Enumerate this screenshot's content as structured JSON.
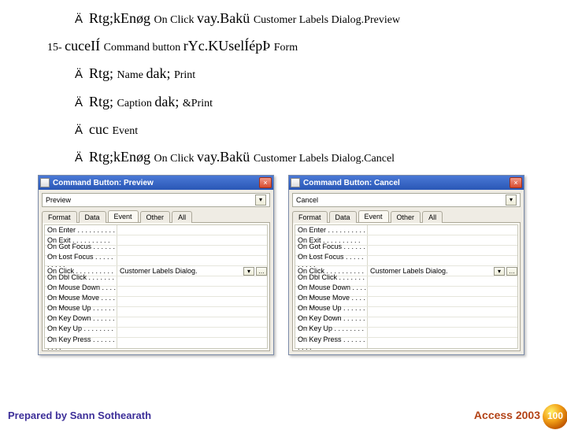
{
  "lines": [
    {
      "indent": "ind1",
      "parts": [
        {
          "cls": "arrow",
          "t": "Ä"
        },
        {
          "cls": "big",
          "t": "Rtg;kEnøg "
        },
        {
          "cls": "small",
          "t": "On Click "
        },
        {
          "cls": "big",
          "t": "vay.Bakü "
        },
        {
          "cls": "small",
          "t": "Customer Labels Dialog.Preview"
        }
      ]
    },
    {
      "indent": "ind0",
      "parts": [
        {
          "cls": "small",
          "t": "15- "
        },
        {
          "cls": "big",
          "t": "cuceIÍ "
        },
        {
          "cls": "small",
          "t": "Command button "
        },
        {
          "cls": "big",
          "t": "rYc.KUselÍépÞ "
        },
        {
          "cls": "small",
          "t": "Form"
        }
      ]
    },
    {
      "indent": "ind1",
      "parts": [
        {
          "cls": "arrow",
          "t": "Ä"
        },
        {
          "cls": "big",
          "t": "Rtg; "
        },
        {
          "cls": "small",
          "t": "Name "
        },
        {
          "cls": "big",
          "t": "dak; "
        },
        {
          "cls": "small",
          "t": "Print"
        }
      ]
    },
    {
      "indent": "ind1",
      "parts": [
        {
          "cls": "arrow",
          "t": "Ä"
        },
        {
          "cls": "big",
          "t": "Rtg; "
        },
        {
          "cls": "small",
          "t": "Caption "
        },
        {
          "cls": "big",
          "t": "dak; "
        },
        {
          "cls": "small",
          "t": "&Print"
        }
      ]
    },
    {
      "indent": "ind1",
      "parts": [
        {
          "cls": "arrow",
          "t": "Ä"
        },
        {
          "cls": "big",
          "t": "cuc "
        },
        {
          "cls": "small",
          "t": "Event"
        }
      ]
    },
    {
      "indent": "ind1",
      "parts": [
        {
          "cls": "arrow",
          "t": "Ä"
        },
        {
          "cls": "big",
          "t": "Rtg;kEnøg "
        },
        {
          "cls": "small",
          "t": "On Click "
        },
        {
          "cls": "big",
          "t": "vay.Bakü "
        },
        {
          "cls": "small",
          "t": "Customer Labels Dialog.Cancel"
        }
      ]
    }
  ],
  "dialogs": [
    {
      "title": "Command Button: Preview",
      "selected": "Preview",
      "click_val": "Customer Labels Dialog."
    },
    {
      "title": "Command Button: Cancel",
      "selected": "Cancel",
      "click_val": "Customer Labels Dialog."
    }
  ],
  "tabs": [
    "Format",
    "Data",
    "Event",
    "Other",
    "All"
  ],
  "active_tab": "Event",
  "events": [
    "On Enter",
    "On Exit",
    "On Got Focus",
    "On Lost Focus",
    "On Click",
    "On Dbl Click",
    "On Mouse Down",
    "On Mouse Move",
    "On Mouse Up",
    "On Key Down",
    "On Key Up",
    "On Key Press"
  ],
  "dots": " . . . . . . . . . .",
  "close_x": "×",
  "dd_arrow": "▾",
  "ellipsis": "…",
  "footer": {
    "prepared": "Prepared by Sann Sothearath",
    "product": "Access 2003",
    "page": "100"
  }
}
